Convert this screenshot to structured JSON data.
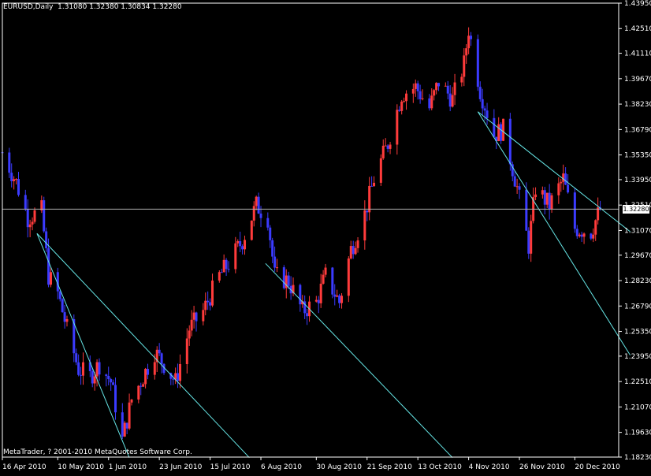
{
  "header": {
    "symbol": "EURUSD,Daily",
    "ohlc": "1.31080 1.32380 1.30834 1.32280"
  },
  "footer": {
    "copyright": "MetaTrader, ? 2001-2010 MetaQuotes Software Corp."
  },
  "current_price_label": "1.32280",
  "colors": {
    "background": "#000000",
    "bull": "#ff3b3b",
    "bear": "#3b3bff",
    "trendline": "#66e6e6",
    "axis": "#ffffff"
  },
  "chart_data": {
    "type": "candlestick",
    "x_tick_labels": [
      "16 Apr 2010",
      "10 May 2010",
      "1 Jun 2010",
      "23 Jun 2010",
      "15 Jul 2010",
      "6 Aug 2010",
      "30 Aug 2010",
      "21 Sep 2010",
      "13 Oct 2010",
      "4 Nov 2010",
      "26 Nov 2010",
      "20 Dec 2010"
    ],
    "y_tick_labels": [
      "1.43950",
      "1.42510",
      "1.41110",
      "1.39670",
      "1.38230",
      "1.36790",
      "1.35350",
      "1.33950",
      "1.32510",
      "1.31070",
      "1.29670",
      "1.28230",
      "1.26790",
      "1.25350",
      "1.23950",
      "1.22510",
      "1.21070",
      "1.19630",
      "1.18230"
    ],
    "ylim": [
      1.1823,
      1.4395
    ],
    "current_price": 1.3228,
    "close_path": [
      {
        "date": "2010-04-16",
        "close": 1.355
      },
      {
        "date": "2010-04-22",
        "close": 1.338
      },
      {
        "date": "2010-04-27",
        "close": 1.318
      },
      {
        "date": "2010-05-03",
        "close": 1.322
      },
      {
        "date": "2010-05-06",
        "close": 1.285
      },
      {
        "date": "2010-05-10",
        "close": 1.275
      },
      {
        "date": "2010-05-14",
        "close": 1.255
      },
      {
        "date": "2010-05-19",
        "close": 1.232
      },
      {
        "date": "2010-05-24",
        "close": 1.228
      },
      {
        "date": "2010-05-28",
        "close": 1.235
      },
      {
        "date": "2010-06-02",
        "close": 1.225
      },
      {
        "date": "2010-06-07",
        "close": 1.192
      },
      {
        "date": "2010-06-11",
        "close": 1.215
      },
      {
        "date": "2010-06-16",
        "close": 1.228
      },
      {
        "date": "2010-06-21",
        "close": 1.242
      },
      {
        "date": "2010-06-25",
        "close": 1.235
      },
      {
        "date": "2010-06-30",
        "close": 1.225
      },
      {
        "date": "2010-07-06",
        "close": 1.255
      },
      {
        "date": "2010-07-12",
        "close": 1.265
      },
      {
        "date": "2010-07-19",
        "close": 1.285
      },
      {
        "date": "2010-07-23",
        "close": 1.292
      },
      {
        "date": "2010-07-29",
        "close": 1.305
      },
      {
        "date": "2010-08-04",
        "close": 1.325
      },
      {
        "date": "2010-08-09",
        "close": 1.318
      },
      {
        "date": "2010-08-12",
        "close": 1.285
      },
      {
        "date": "2010-08-18",
        "close": 1.282
      },
      {
        "date": "2010-08-24",
        "close": 1.265
      },
      {
        "date": "2010-08-30",
        "close": 1.27
      },
      {
        "date": "2010-09-03",
        "close": 1.285
      },
      {
        "date": "2010-09-09",
        "close": 1.27
      },
      {
        "date": "2010-09-14",
        "close": 1.3
      },
      {
        "date": "2010-09-20",
        "close": 1.32
      },
      {
        "date": "2010-09-24",
        "close": 1.34
      },
      {
        "date": "2010-09-30",
        "close": 1.36
      },
      {
        "date": "2010-10-06",
        "close": 1.388
      },
      {
        "date": "2010-10-12",
        "close": 1.392
      },
      {
        "date": "2010-10-18",
        "close": 1.38
      },
      {
        "date": "2010-10-22",
        "close": 1.395
      },
      {
        "date": "2010-10-28",
        "close": 1.385
      },
      {
        "date": "2010-11-02",
        "close": 1.405
      },
      {
        "date": "2010-11-04",
        "close": 1.425
      },
      {
        "date": "2010-11-09",
        "close": 1.39
      },
      {
        "date": "2010-11-15",
        "close": 1.365
      },
      {
        "date": "2010-11-19",
        "close": 1.368
      },
      {
        "date": "2010-11-25",
        "close": 1.335
      },
      {
        "date": "2010-11-30",
        "close": 1.302
      },
      {
        "date": "2010-12-03",
        "close": 1.335
      },
      {
        "date": "2010-12-09",
        "close": 1.325
      },
      {
        "date": "2010-12-15",
        "close": 1.34
      },
      {
        "date": "2010-12-20",
        "close": 1.312
      },
      {
        "date": "2010-12-27",
        "close": 1.31
      },
      {
        "date": "2010-12-31",
        "close": 1.3228
      }
    ],
    "trendlines": [
      {
        "from": {
          "date": "2010-05-01",
          "price": 1.309
        },
        "to": {
          "date": "2010-08-01",
          "price": 1.182
        }
      },
      {
        "from": {
          "date": "2010-05-01",
          "price": 1.309
        },
        "to": {
          "date": "2010-06-10",
          "price": 1.182
        }
      },
      {
        "from": {
          "date": "2010-08-08",
          "price": 1.292
        },
        "to": {
          "date": "2010-10-28",
          "price": 1.182
        }
      },
      {
        "from": {
          "date": "2010-11-08",
          "price": 1.378
        },
        "to": {
          "date": "2011-01-13",
          "price": 1.31
        }
      },
      {
        "from": {
          "date": "2010-11-08",
          "price": 1.378
        },
        "to": {
          "date": "2011-01-13",
          "price": 1.24
        }
      }
    ]
  }
}
